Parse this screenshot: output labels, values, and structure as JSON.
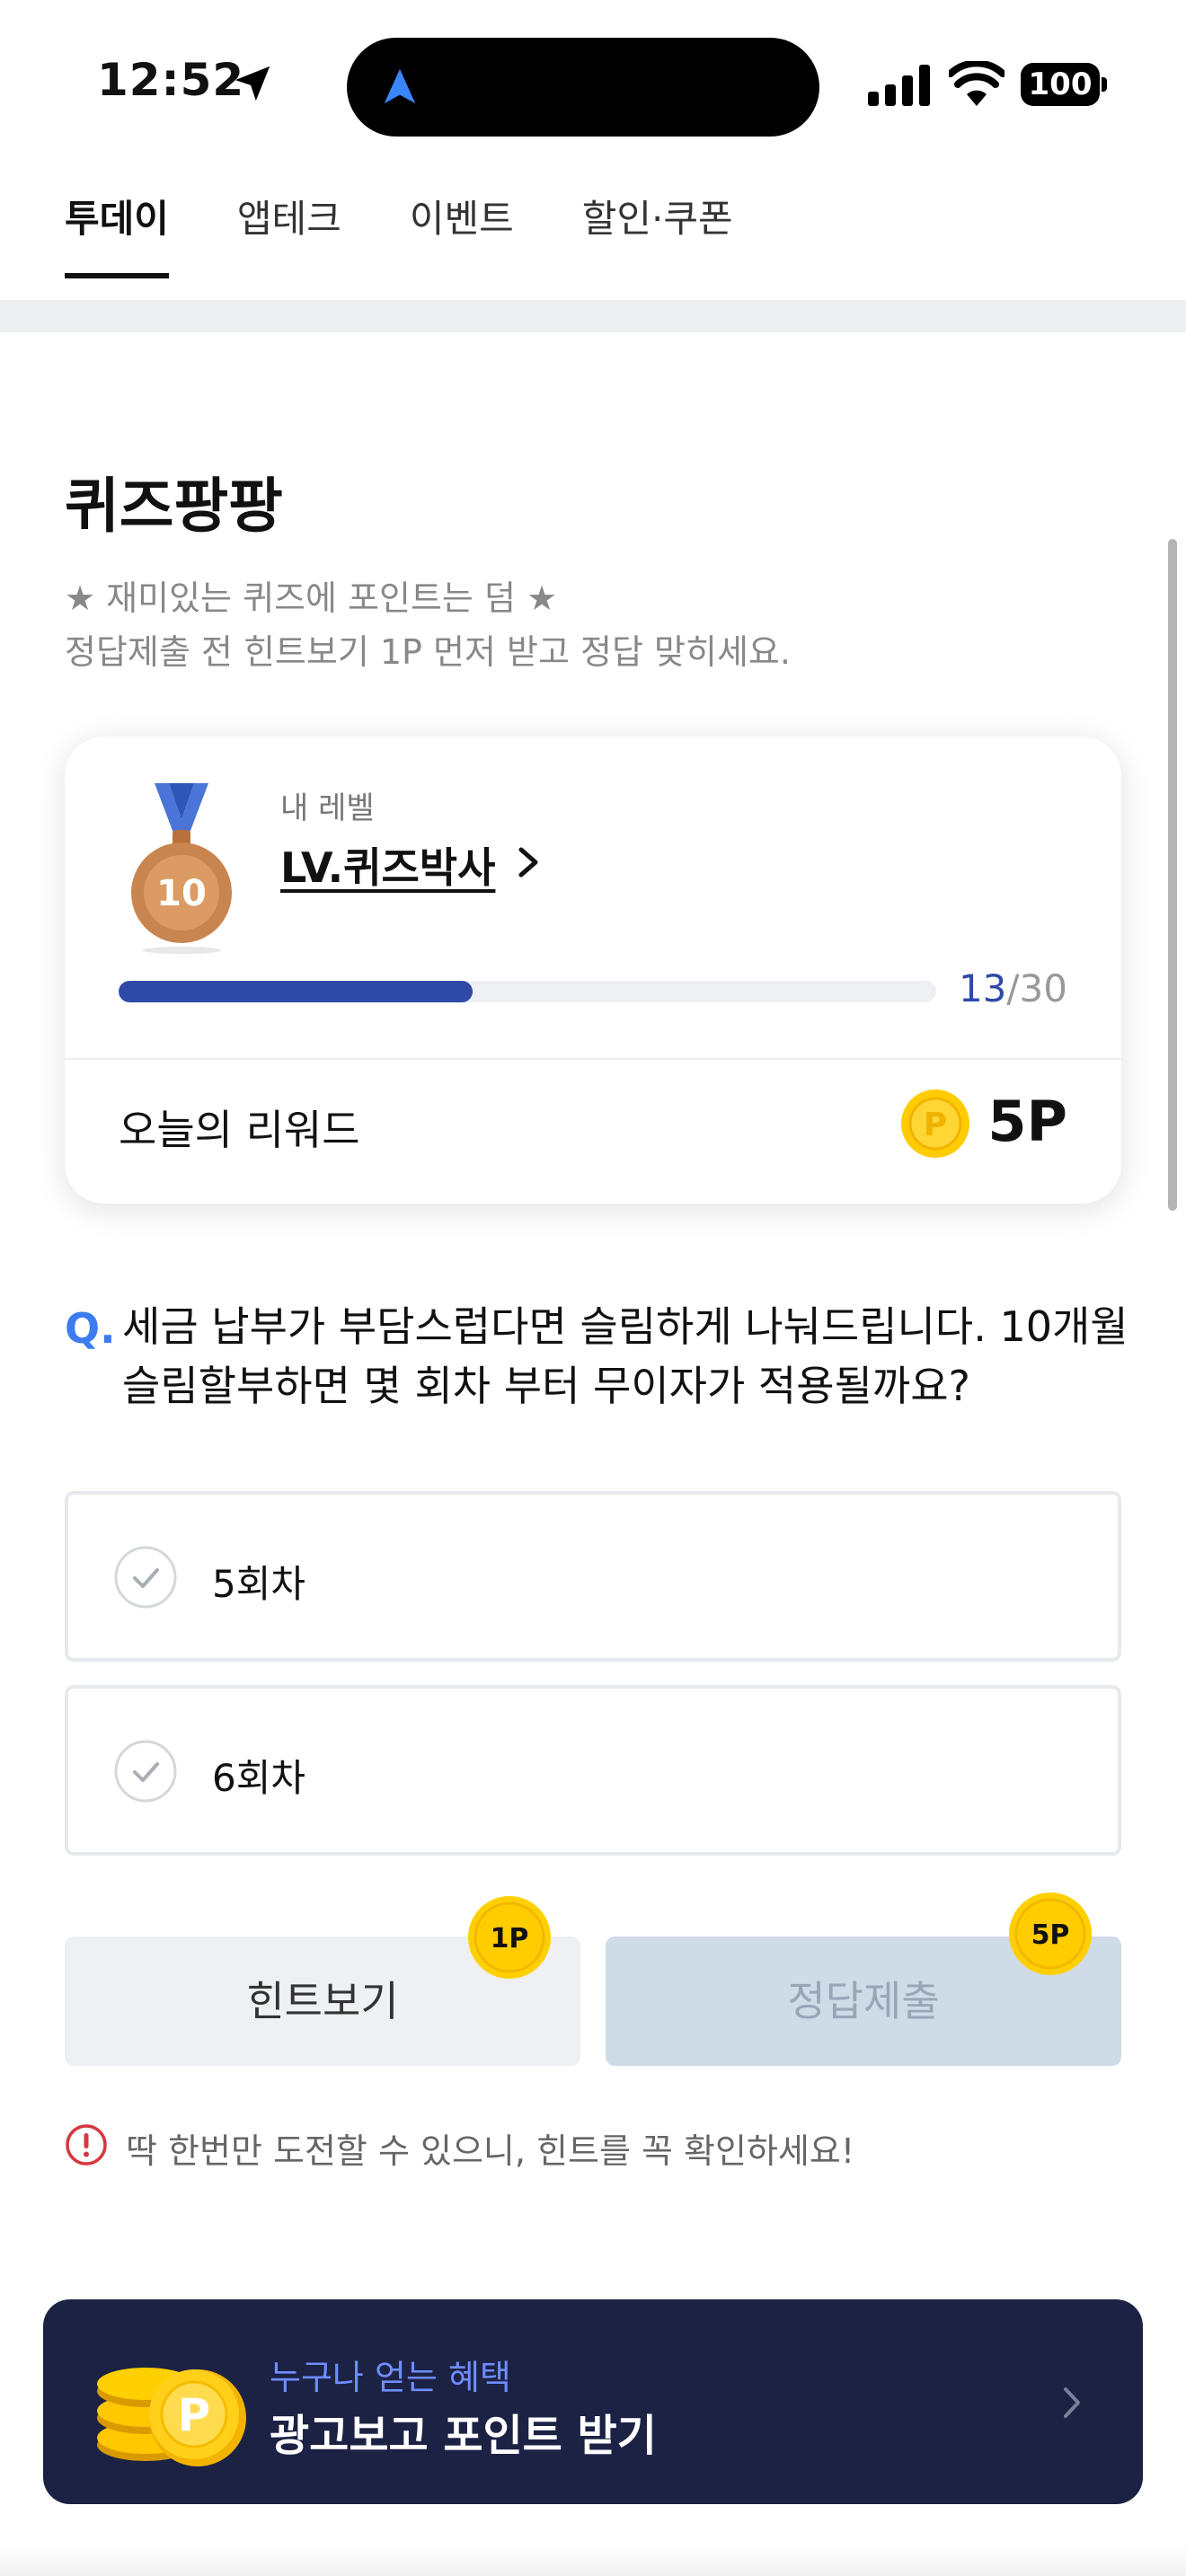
{
  "status_bar": {
    "time": "12:52",
    "battery": "100"
  },
  "tabs": [
    {
      "label": "투데이",
      "active": true
    },
    {
      "label": "앱테크",
      "active": false
    },
    {
      "label": "이벤트",
      "active": false
    },
    {
      "label": "할인·쿠폰",
      "active": false
    }
  ],
  "quiz": {
    "title": "퀴즈팡팡",
    "subtitle_line1": "★ 재미있는 퀴즈에 포인트는 덤 ★",
    "subtitle_line2": "정답제출 전 힌트보기 1P 먼저 받고 정답 맞히세요."
  },
  "level_card": {
    "medal_number": "10",
    "label": "내 레벨",
    "level_name": "LV.퀴즈박사",
    "progress_current": "13",
    "progress_total": "/30",
    "progress_fraction": 0.433,
    "reward_label": "오늘의 리워드",
    "reward_value": "5P",
    "coin_symbol": "P"
  },
  "question": {
    "marker": "Q.",
    "text": "세금 납부가 부담스럽다면 슬림하게 나눠드립니다. 10개월 슬림할부하면 몇 회차 부터 무이자가 적용될까요?",
    "options": [
      "5회차",
      "6회차"
    ]
  },
  "buttons": {
    "hint_label": "힌트보기",
    "hint_badge": "1P",
    "submit_label": "정답제출",
    "submit_badge": "5P"
  },
  "warning": {
    "text": "딱 한번만 도전할 수 있으니, 힌트를 꼭 확인하세요!"
  },
  "ad_banner": {
    "subtitle": "누구나 얻는 혜택",
    "title": "광고보고 포인트 받기",
    "coin_symbol": "P"
  },
  "colors": {
    "accent_blue": "#2f4aa6",
    "question_blue": "#3d7cf0",
    "banner_bg": "#1c2244",
    "coin_gold": "#ffc700"
  }
}
